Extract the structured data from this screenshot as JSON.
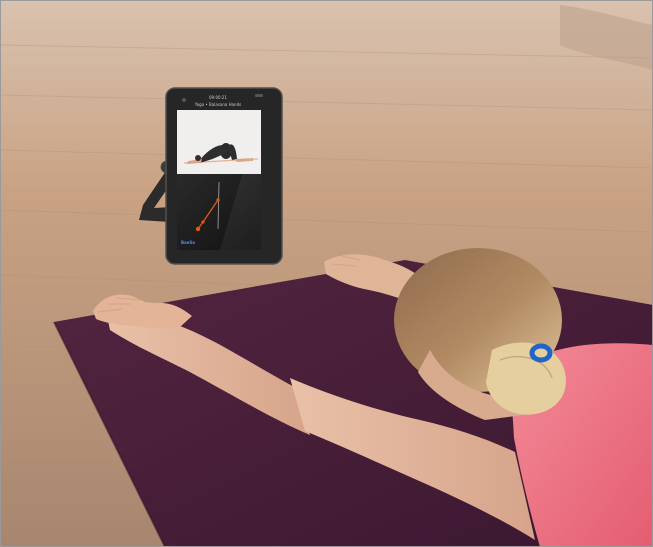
{
  "tablet": {
    "time": "09:00:21",
    "subtitle": "Yoga • Balasana Hands",
    "brand": "Baelia"
  },
  "palette": {
    "floor": "#c9a283",
    "mat": "#4a2038",
    "shirt": "#ea6f80",
    "skin": "#e8bba0",
    "hair": "#c59a6a",
    "hair_tie": "#1f66c8",
    "tablet_body": "#262626",
    "screen_top": "#f1efee",
    "screen_bottom": "#191919",
    "motion_line": "#e05a16"
  }
}
